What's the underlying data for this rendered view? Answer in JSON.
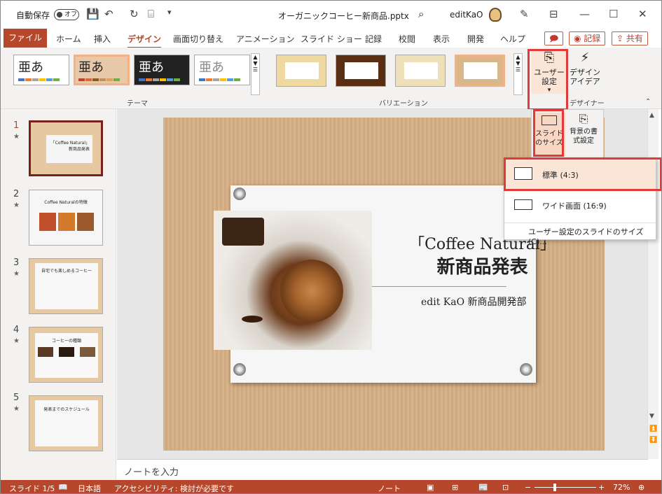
{
  "titlebar": {
    "autosave": "自動保存",
    "toggle": "オフ",
    "doc_title": "オーガニックコーヒー新商品.pptx",
    "user": "editKaO"
  },
  "tabs": {
    "file": "ファイル",
    "items": [
      "ホーム",
      "挿入",
      "デザイン",
      "画面切り替え",
      "アニメーション",
      "スライド ショー",
      "記録",
      "校閲",
      "表示",
      "開発",
      "ヘルプ"
    ],
    "record": "記録",
    "share": "共有"
  },
  "ribbon": {
    "themes_label": "テーマ",
    "variations_label": "バリエーション",
    "designer_label": "デザイナー",
    "custom_label": "ユーザー設定",
    "design_ideas_label": "デザイン\nアイデア",
    "theme_glyph": "亜あ",
    "slide_size_label": "スライドのサイズ",
    "bg_format_label": "背景の書式設定"
  },
  "slide_size_menu": {
    "standard": "標準 (4:3)",
    "wide": "ワイド画面 (16:9)",
    "custom": "ユーザー設定のスライドのサイズ(C)..."
  },
  "thumbnails": [
    {
      "num": "1"
    },
    {
      "num": "2"
    },
    {
      "num": "3"
    },
    {
      "num": "4"
    },
    {
      "num": "5"
    }
  ],
  "thumb_titles": [
    "「Coffee Natural」新商品発表",
    "Coffee Naturalの特徴",
    "自宅でも楽しめるコーヒー",
    "コーヒーの種類",
    "発表までのスケジュール"
  ],
  "slide": {
    "title_line1": "「Coffee Natural」",
    "title_line2": "新商品発表",
    "subtitle": "edit KaO 新商品開発部"
  },
  "notes_placeholder": "ノートを入力",
  "status": {
    "slide": "スライド 1/5",
    "lang": "日本語",
    "accessibility": "アクセシビリティ: 検討が必要です",
    "notes": "ノート",
    "zoom": "72%"
  },
  "colors": {
    "accent": "#b7472a",
    "highlight": "#e03a3a"
  }
}
